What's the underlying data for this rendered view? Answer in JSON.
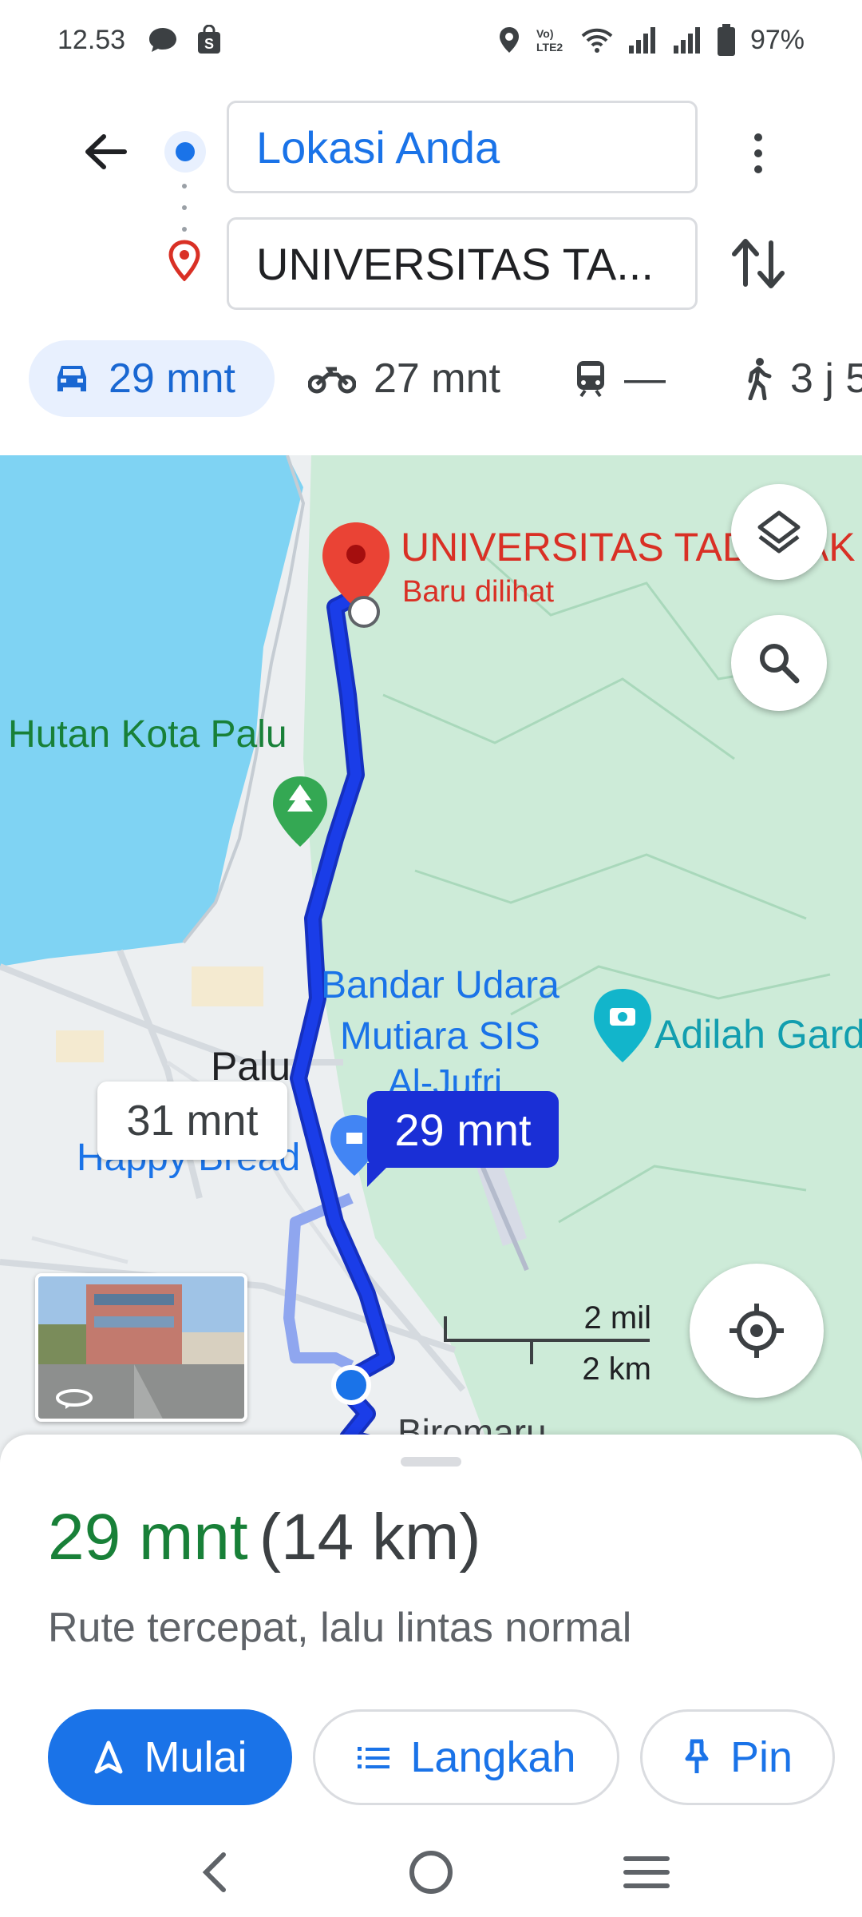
{
  "status_bar": {
    "time": "12.53",
    "battery": "97%",
    "icons": [
      "message-icon",
      "shop-bag-icon",
      "location-icon",
      "volte-icon",
      "wifi-icon",
      "signal-icon",
      "signal-icon",
      "battery-icon"
    ]
  },
  "directions": {
    "origin": "Lokasi Anda",
    "destination": "UNIVERSITAS TA..."
  },
  "modes": [
    {
      "name": "car",
      "label": "29 mnt",
      "selected": true
    },
    {
      "name": "motorcycle",
      "label": "27 mnt"
    },
    {
      "name": "transit",
      "label": "—"
    },
    {
      "name": "walk",
      "label": "3 j 5"
    }
  ],
  "map": {
    "destination_label": "UNIVERSITAS TADULAK",
    "destination_sub": "Baru dilihat",
    "place_hutan": "n Hutan Kota Palu",
    "place_palu": "Palu",
    "airport_line1": "Bandar Udara",
    "airport_line2": "Mutiara SIS",
    "airport_line3": "Al-Jufri",
    "place_adilah": "Adilah Gard",
    "place_happy": "Happy Bread",
    "place_biromaru": "Biromaru",
    "eta_alt": "31 mnt",
    "eta_main": "29 mnt",
    "scale_mil": "2 mil",
    "scale_km": "2 km",
    "colors": {
      "route": "#1a3de8",
      "alt_route": "#8fa6ef",
      "water": "#7fd3f3",
      "park": "#c9ead4"
    }
  },
  "sheet": {
    "duration": "29 mnt",
    "distance": "(14 km)",
    "description": "Rute tercepat, lalu lintas normal",
    "start_label": "Mulai",
    "steps_label": "Langkah",
    "pin_label": "Pin"
  }
}
